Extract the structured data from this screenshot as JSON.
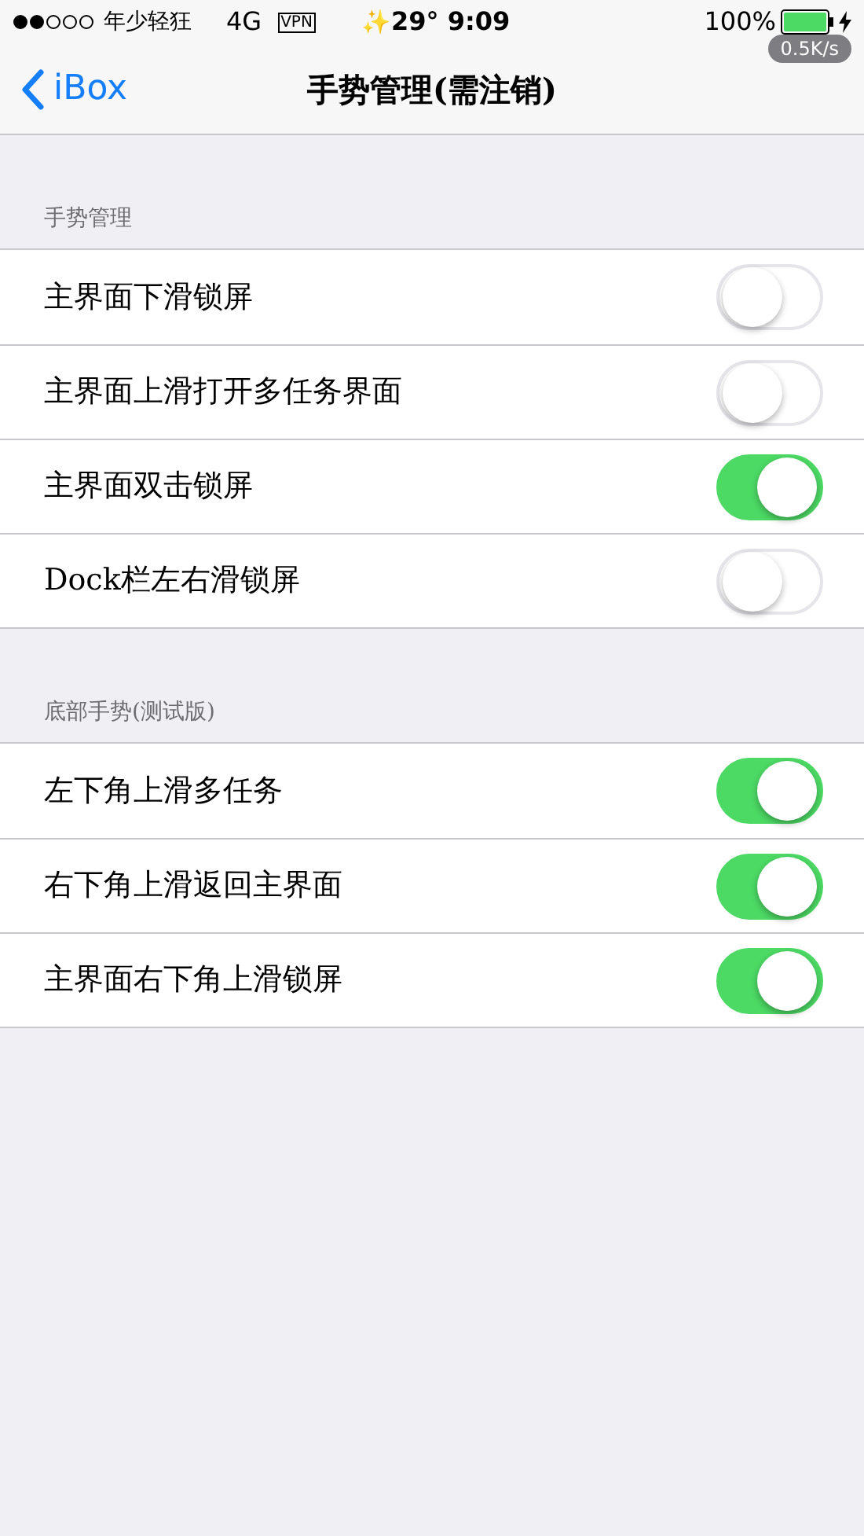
{
  "status_bar": {
    "carrier": "年少轻狂",
    "network": "4G",
    "vpn": "VPN",
    "weather_icon": "✨",
    "time": "29° 9:09",
    "battery": "100%",
    "speed": "0.5K/s"
  },
  "nav": {
    "back": "iBox",
    "title": "手势管理(需注销)"
  },
  "sections": [
    {
      "header": "手势管理",
      "rows": [
        {
          "label": "主界面下滑锁屏",
          "on": false
        },
        {
          "label": "主界面上滑打开多任务界面",
          "on": false
        },
        {
          "label": "主界面双击锁屏",
          "on": true
        },
        {
          "label": "Dock栏左右滑锁屏",
          "on": false
        }
      ]
    },
    {
      "header": "底部手势(测试版)",
      "rows": [
        {
          "label": "左下角上滑多任务",
          "on": true
        },
        {
          "label": "右下角上滑返回主界面",
          "on": true
        },
        {
          "label": "主界面右下角上滑锁屏",
          "on": true
        }
      ]
    }
  ]
}
